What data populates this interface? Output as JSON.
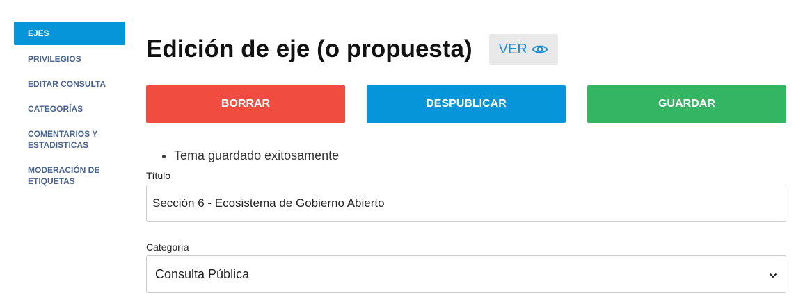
{
  "sidebar": {
    "items": [
      {
        "label": "EJES",
        "active": true
      },
      {
        "label": "PRIVILEGIOS"
      },
      {
        "label": "EDITAR CONSULTA"
      },
      {
        "label": "CATEGORÍAS"
      },
      {
        "label": "COMENTARIOS Y ESTADISTICAS"
      },
      {
        "label": "MODERACIÓN DE ETIQUETAS"
      }
    ]
  },
  "header": {
    "title": "Edición de eje (o propuesta)",
    "view_label": "VER"
  },
  "actions": {
    "delete_label": "BORRAR",
    "unpublish_label": "DESPUBLICAR",
    "save_label": "GUARDAR"
  },
  "messages": [
    "Tema guardado exitosamente"
  ],
  "form": {
    "title_label": "Título",
    "title_value": "Sección 6 - Ecosistema de Gobierno Abierto",
    "category_label": "Categoría",
    "category_value": "Consulta Pública"
  },
  "colors": {
    "accent": "#0795d9",
    "delete": "#f04c3f",
    "save": "#34b563",
    "sidebar_text": "#4a6391"
  }
}
